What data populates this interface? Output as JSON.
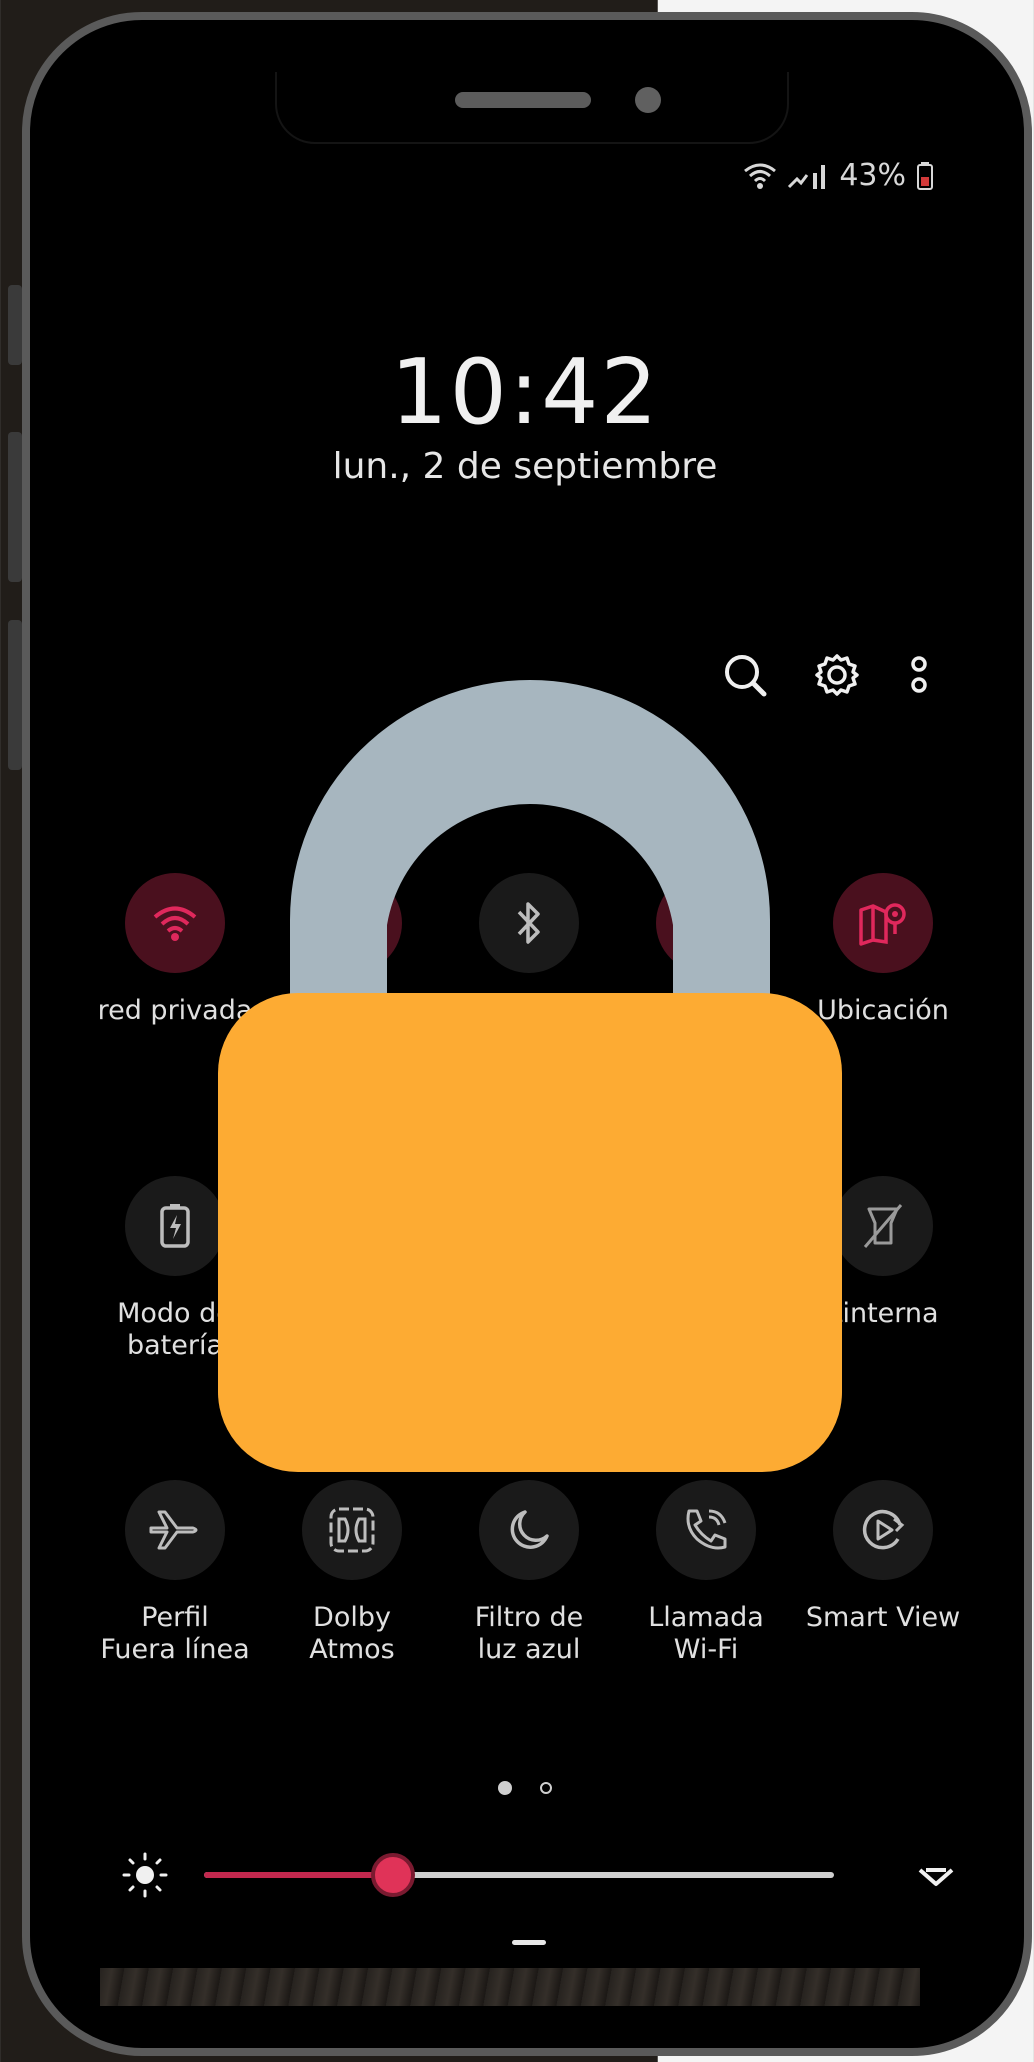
{
  "status_bar": {
    "battery_percent": "43%",
    "wifi_icon": "wifi-icon",
    "signal_icon": "cellular-signal-icon",
    "battery_icon": "battery-icon"
  },
  "lockscreen": {
    "time": "10:42",
    "date": "lun., 2 de septiembre"
  },
  "toolbar_icons": [
    "search-icon",
    "gear-icon",
    "more-options-icon"
  ],
  "tiles_row1": [
    {
      "label": "red privada",
      "icon": "wifi-icon",
      "active": true
    },
    {
      "label": "",
      "icon": "mute-icon",
      "active": true
    },
    {
      "label": "",
      "icon": "bluetooth-icon",
      "active": false
    },
    {
      "label": "",
      "icon": "rotate-icon",
      "active": true
    },
    {
      "label": "Ubicación",
      "icon": "location-icon",
      "active": true
    }
  ],
  "tiles_row2": [
    {
      "label": "Modo de\nbatería",
      "icon": "battery-saver-icon",
      "active": false
    },
    {
      "label": "Linterna",
      "icon": "flashlight-icon",
      "active": false
    }
  ],
  "tiles_row3": [
    {
      "label": "Perfil\nFuera línea",
      "icon": "airplane-icon",
      "active": false
    },
    {
      "label": "Dolby\nAtmos",
      "icon": "dolby-icon",
      "active": false
    },
    {
      "label": "Filtro de\nluz azul",
      "icon": "moon-icon",
      "active": false
    },
    {
      "label": "Llamada\nWi-Fi",
      "icon": "wifi-call-icon",
      "active": false
    },
    {
      "label": "Smart View",
      "icon": "smart-view-icon",
      "active": false
    }
  ],
  "pager": {
    "current_page": 1,
    "total_pages": 2
  },
  "brightness": {
    "level": 0.3
  },
  "colors": {
    "accent": "#c2284e",
    "tile_active_bg": "#4a101e",
    "lock_body": "#fdab33",
    "lock_shackle": "#a7b6bf"
  },
  "overlay_icon": "padlock-icon"
}
